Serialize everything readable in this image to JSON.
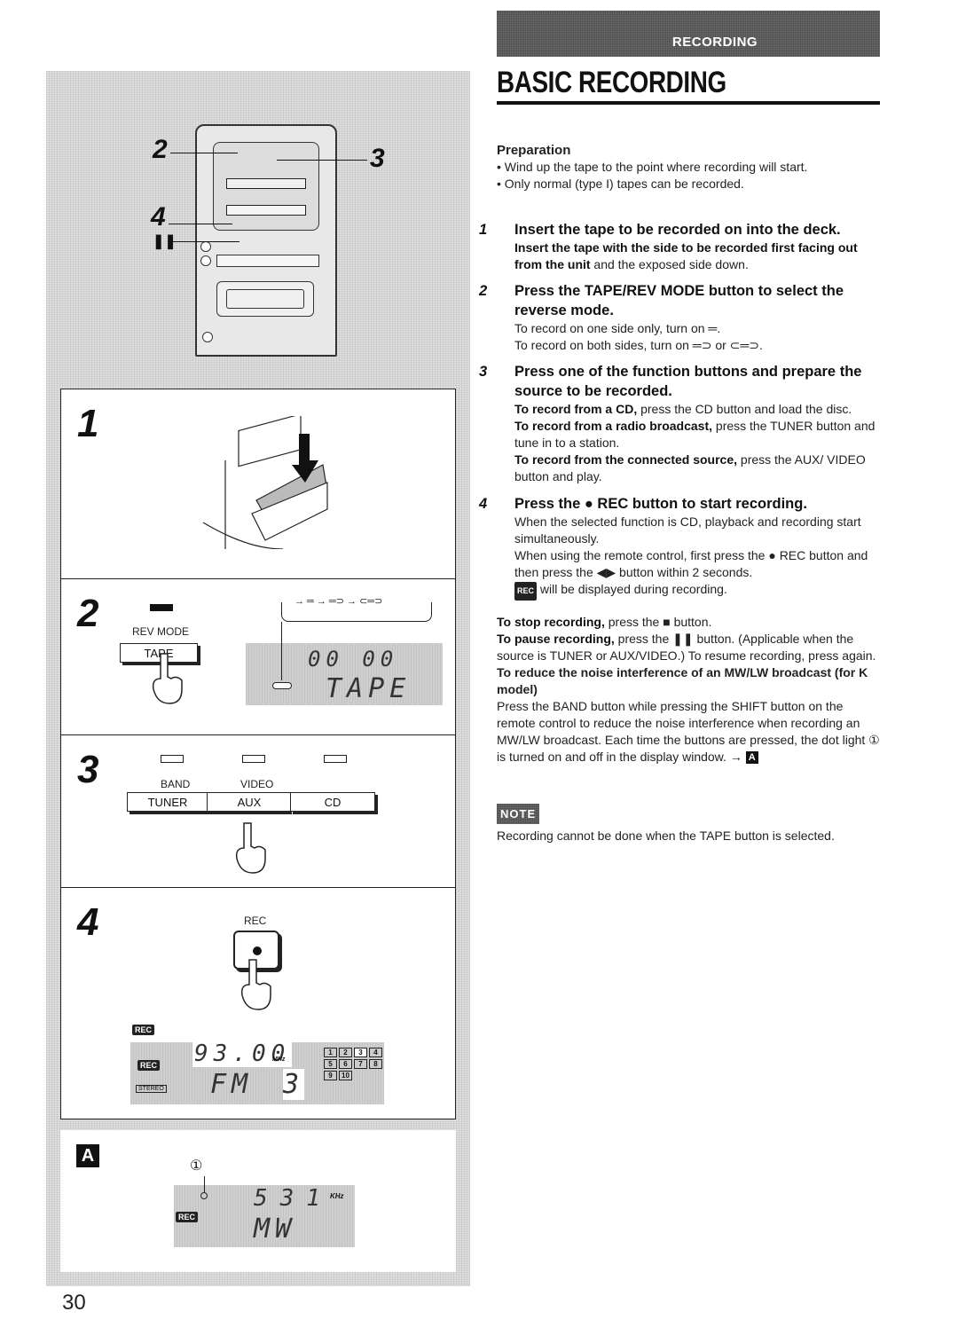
{
  "header": {
    "section": "RECORDING",
    "title": "BASIC RECORDING"
  },
  "preparation": {
    "heading": "Preparation",
    "bullets": [
      "• Wind up the tape to the point where recording will start.",
      "• Only normal (type I) tapes can be recorded."
    ]
  },
  "steps": [
    {
      "num": "1",
      "heading": "Insert the tape to be recorded on into the deck.",
      "body_bold": "Insert the tape with the side to be recorded first facing out from the unit",
      "body": " and the exposed side down."
    },
    {
      "num": "2",
      "heading": "Press the TAPE/REV MODE button to select the reverse mode.",
      "lines": [
        "To record on one side only, turn on ═.",
        "To record on both sides, turn on ═⊃ or ⊂═⊃."
      ]
    },
    {
      "num": "3",
      "heading": "Press one of the function buttons and prepare the source to be recorded.",
      "items": [
        {
          "bold": "To record from a CD,",
          "text": " press the CD button and load the disc."
        },
        {
          "bold": "To record from a radio broadcast,",
          "text": " press the TUNER button and tune in to a station."
        },
        {
          "bold": "To record from the connected source,",
          "text": " press the AUX/ VIDEO button and play."
        }
      ]
    },
    {
      "num": "4",
      "heading": "Press the ● REC button to start recording.",
      "lines": [
        "When the selected function is CD, playback and recording start simultaneously.",
        "When using the remote control, first press the ● REC button and then press the ◀▶ button within 2 seconds.",
        " will be displayed during recording."
      ],
      "rec_indicator": "REC"
    }
  ],
  "extra": {
    "stop": {
      "bold": "To stop recording,",
      "text": " press the ■ button."
    },
    "pause": {
      "bold": "To pause recording,",
      "text": " press the ❚❚ button. (Applicable when the source is TUNER or AUX/VIDEO.)  To resume recording, press again."
    },
    "noise_heading": "To reduce the noise interference of an MW/LW broadcast (for K model)",
    "noise_body": "Press the BAND button while pressing the SHIFT button on the remote control to reduce the noise interference when recording an MW/LW broadcast. Each time the buttons are pressed, the dot light ① is turned on and off in the display window. →",
    "noise_ref": "A"
  },
  "note": {
    "badge": "NOTE",
    "text": "Recording cannot be done when the TAPE button is selected."
  },
  "illustrations": {
    "device_callouts": [
      "2",
      "3",
      "4",
      "❚❚"
    ],
    "step1_label": "1",
    "step2": {
      "label": "2",
      "rev_mode": "REV MODE",
      "tape_button": "TAPE",
      "mode_cycle": "→ ═ → ═⊃ → ⊂═⊃",
      "display_counter": "00 00",
      "display_text": "TAPE"
    },
    "step3": {
      "label": "3",
      "sub_labels": [
        "BAND",
        "VIDEO",
        ""
      ],
      "buttons": [
        "TUNER",
        "AUX",
        "CD"
      ]
    },
    "step4": {
      "label": "4",
      "rec_label": "REC",
      "rec_badge": "REC",
      "frequency": "93.00",
      "freq_unit": "MHz",
      "band": "FM",
      "preset": "3",
      "stereo": "STEREO",
      "presets": [
        "1",
        "2",
        "3",
        "4",
        "5",
        "6",
        "7",
        "8",
        "9",
        "10"
      ]
    },
    "panel_a": {
      "label": "A",
      "marker": "①",
      "frequency": "531",
      "freq_unit": "KHz",
      "band": "MW",
      "rec_badge": "REC"
    }
  },
  "page_number": "30"
}
